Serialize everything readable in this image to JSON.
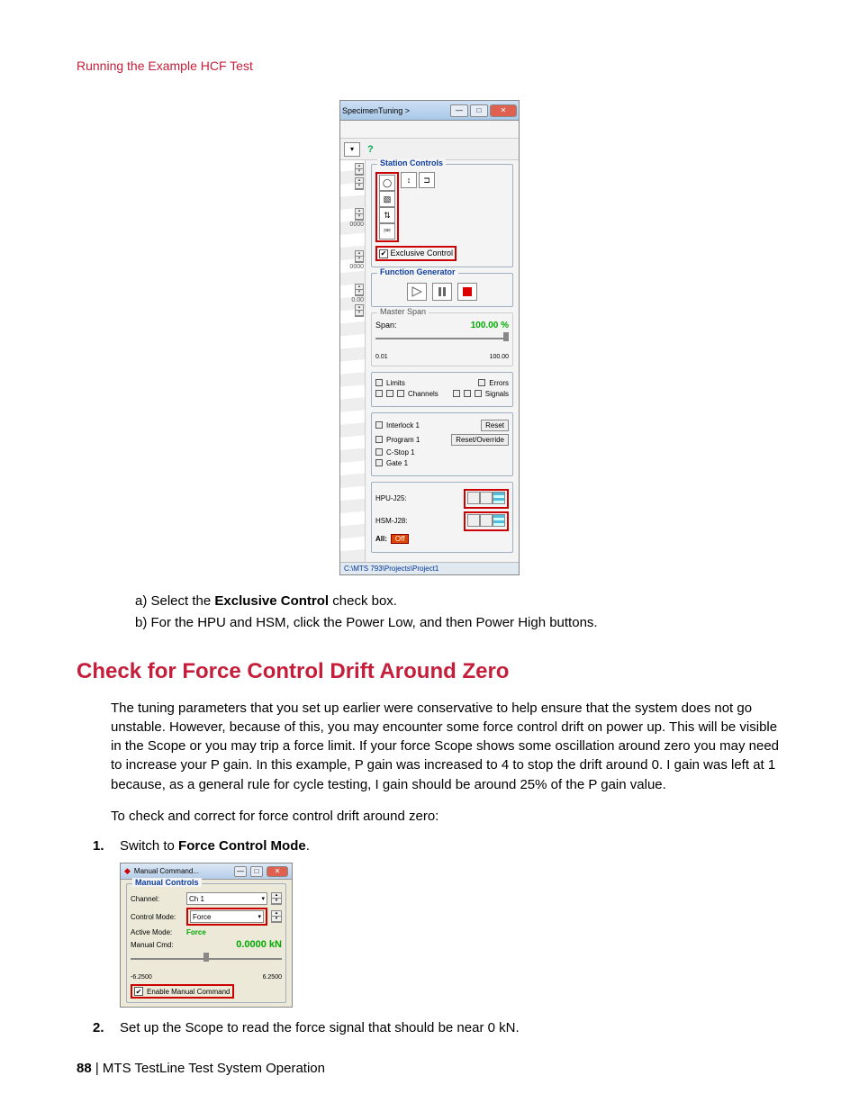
{
  "header": {
    "breadcrumb": "Running the Example HCF Test"
  },
  "screenshot1": {
    "title_prefix": "SpecimenTuning >",
    "station_controls_title": "Station Controls",
    "exclusive_control_label": "Exclusive Control",
    "function_generator_title": "Function Generator",
    "master_span_title": "Master Span",
    "span_label": "Span:",
    "span_value": "100.00 %",
    "span_min": "0.01",
    "span_max": "100.00",
    "status": {
      "limits": "Limits",
      "errors": "Errors",
      "channels": "Channels",
      "signals": "Signals",
      "interlock": "Interlock 1",
      "reset": "Reset",
      "program": "Program 1",
      "reset_override": "Reset/Override",
      "cstop": "C-Stop 1",
      "gate": "Gate 1"
    },
    "power": {
      "hpu": "HPU-J25:",
      "hsm": "HSM-J28:",
      "all": "All:",
      "off": "Off"
    },
    "path": "C:\\MTS 793\\Projects\\Project1",
    "left_ticks": [
      "0000",
      "0000",
      "0.00"
    ]
  },
  "instructions": {
    "a": "a)  Select the ",
    "a_bold": "Exclusive Control",
    "a_tail": " check box.",
    "b": "b)  For the HPU and HSM, click the Power Low, and then Power High buttons."
  },
  "section2": {
    "heading": "Check for Force Control Drift Around Zero",
    "para1": "The tuning parameters that you set up earlier were conservative to help ensure that the system does not go unstable. However, because of this, you may encounter some force control drift on power up. This will be visible in the Scope or you may trip a force limit. If your force Scope shows some oscillation around zero you may need to increase your P gain. In this example, P gain was increased to 4 to stop the drift around 0. I gain was left at 1 because, as a general rule for cycle testing, I gain should be around 25% of the P gain value.",
    "para2": "To check and correct for force control drift around zero:",
    "step1_pre": "Switch to ",
    "step1_bold": "Force Control Mode",
    "step1_tail": ".",
    "step2": "Set up the Scope to read the force signal that should be near 0 kN."
  },
  "screenshot2": {
    "title": "Manual Command...",
    "group_title": "Manual Controls",
    "channel_label": "Channel:",
    "channel_value": "Ch 1",
    "mode_label": "Control Mode:",
    "mode_value": "Force",
    "active_label": "Active Mode:",
    "active_value": "Force",
    "cmd_label": "Manual Cmd:",
    "cmd_value": "0.0000 kN",
    "slider_min": "-6.2500",
    "slider_max": "6.2500",
    "enable_label": "Enable Manual Command"
  },
  "footer": {
    "page": "88",
    "sep": " | ",
    "title": "MTS TestLine Test System Operation"
  }
}
